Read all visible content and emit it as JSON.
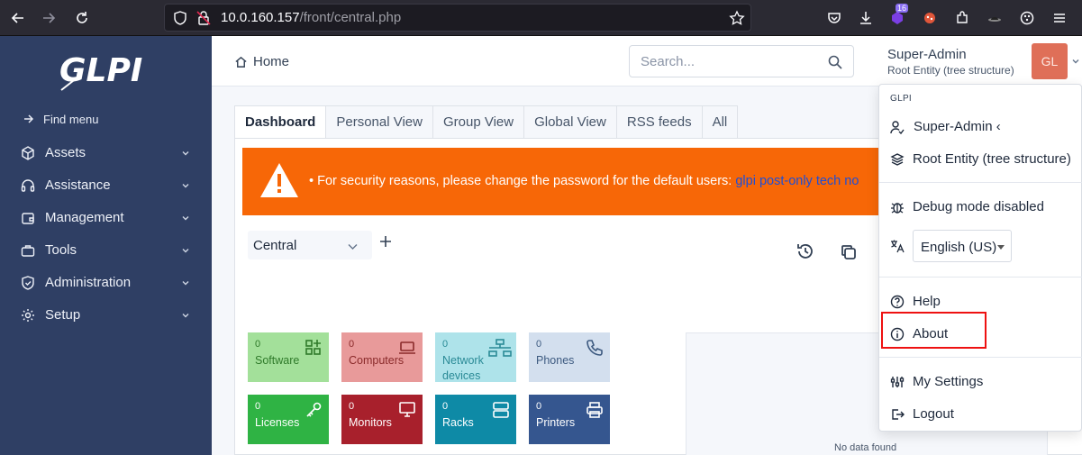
{
  "browser": {
    "url_host": "10.0.160.157",
    "url_path": "/front/central.php",
    "badge_count": "16"
  },
  "sidebar": {
    "logo_text": "GLPI",
    "find_menu": "Find menu",
    "items": [
      {
        "label": "Assets"
      },
      {
        "label": "Assistance"
      },
      {
        "label": "Management"
      },
      {
        "label": "Tools"
      },
      {
        "label": "Administration"
      },
      {
        "label": "Setup"
      }
    ]
  },
  "header": {
    "breadcrumb": "Home",
    "search_placeholder": "Search...",
    "user_name": "Super-Admin",
    "user_entity": "Root Entity (tree structure)",
    "avatar_initials": "GL"
  },
  "tabs": [
    "Dashboard",
    "Personal View",
    "Group View",
    "Global View",
    "RSS feeds",
    "All"
  ],
  "alert": {
    "message": "For security reasons, please change the password for the default users: ",
    "link": "glpi post-only tech no"
  },
  "dashboard": {
    "selected": "Central",
    "no_data": "No data found",
    "cards": [
      {
        "count": "0",
        "label": "Software",
        "color": "#a3e09a",
        "text": "#2f7a2a"
      },
      {
        "count": "0",
        "label": "Computers",
        "color": "#e89a9a",
        "text": "#8a2a2a"
      },
      {
        "count": "0",
        "label": "Network devices",
        "color": "#aee3ea",
        "text": "#2a8a96"
      },
      {
        "count": "0",
        "label": "Phones",
        "color": "#d3dfee",
        "text": "#3d5a80"
      },
      {
        "count": "0",
        "label": "Licenses",
        "color": "#2fb344",
        "text": "#ffffff"
      },
      {
        "count": "0",
        "label": "Monitors",
        "color": "#a8202c",
        "text": "#ffffff"
      },
      {
        "count": "0",
        "label": "Racks",
        "color": "#0e8aa6",
        "text": "#ffffff"
      },
      {
        "count": "0",
        "label": "Printers",
        "color": "#35568f",
        "text": "#ffffff"
      }
    ]
  },
  "dropdown": {
    "header": "GLPI",
    "profile": "Super-Admin",
    "entity": "Root Entity (tree structure)",
    "debug": "Debug mode disabled",
    "language": "English (US)",
    "help": "Help",
    "about": "About",
    "settings": "My Settings",
    "logout": "Logout"
  },
  "colors": {
    "sidebar_bg": "#2f3f64",
    "alert_bg": "#f76707",
    "highlight": "#ee1111"
  }
}
